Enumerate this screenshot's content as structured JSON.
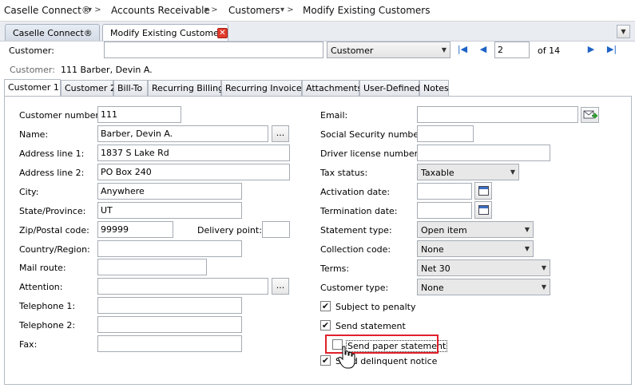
{
  "breadcrumb": {
    "items": [
      "Caselle Connect®",
      "Accounts Receivable",
      "Customers",
      "Modify Existing Customers"
    ]
  },
  "doc_tabs": {
    "home": "Caselle Connect®",
    "active": "Modify Existing Customers"
  },
  "toolbar": {
    "customer_label": "Customer:",
    "customer_value": "",
    "search_by": "Customer",
    "page_value": "2",
    "page_of": "of 14"
  },
  "header": {
    "customer_label": "Customer:",
    "customer_value": "111  Barber, Devin A."
  },
  "tabs": [
    "Customer 1",
    "Customer 2",
    "Bill-To",
    "Recurring Billings",
    "Recurring Invoices",
    "Attachments",
    "User-Defined",
    "Notes"
  ],
  "left": {
    "customer_number_label": "Customer number:",
    "customer_number": "111",
    "name_label": "Name:",
    "name": "Barber, Devin A.",
    "address1_label": "Address line 1:",
    "address1": "1837 S Lake Rd",
    "address2_label": "Address line 2:",
    "address2": "PO Box 240",
    "city_label": "City:",
    "city": "Anywhere",
    "state_label": "State/Province:",
    "state": "UT",
    "zip_label": "Zip/Postal code:",
    "zip": "99999",
    "delivery_label": "Delivery point:",
    "delivery": "",
    "country_label": "Country/Region:",
    "country": "",
    "mail_route_label": "Mail route:",
    "mail_route": "",
    "attention_label": "Attention:",
    "attention": "",
    "tel1_label": "Telephone 1:",
    "tel1": "",
    "tel2_label": "Telephone 2:",
    "tel2": "",
    "fax_label": "Fax:",
    "fax": "",
    "ellipsis": "..."
  },
  "right": {
    "email_label": "Email:",
    "email": "",
    "ssn_label": "Social Security number:",
    "ssn": "",
    "dl_label": "Driver license number:",
    "dl": "",
    "tax_label": "Tax status:",
    "tax": "Taxable",
    "activation_label": "Activation date:",
    "activation": "",
    "termination_label": "Termination date:",
    "termination": "",
    "statement_type_label": "Statement type:",
    "statement_type": "Open item",
    "collection_label": "Collection code:",
    "collection": "None",
    "terms_label": "Terms:",
    "terms": "Net 30",
    "customer_type_label": "Customer type:",
    "customer_type": "None",
    "subject_penalty": "Subject to penalty",
    "send_statement": "Send statement",
    "send_paper_statement": "Send paper statement",
    "send_delinquent": "Send delinquent notice"
  },
  "checks": {
    "subject_penalty": true,
    "send_statement": true,
    "send_paper_statement": false,
    "send_delinquent": true
  },
  "colors": {
    "highlight": "#e0202a",
    "nav_blue": "#1f63c6"
  }
}
